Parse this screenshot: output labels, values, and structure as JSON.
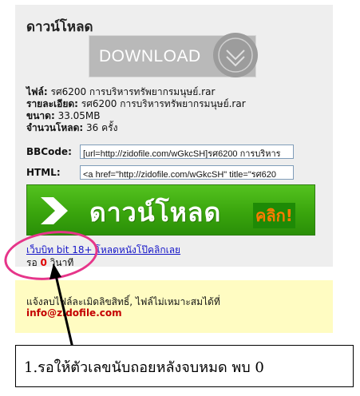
{
  "panel": {
    "title": "ดาวน์โหลด",
    "download_button_label": "DOWNLOAD",
    "file_label": "ไฟล์:",
    "file_value": "รศ6200 การบริหารทรัพยากรมนุษย์.rar",
    "detail_label": "รายละเอียด:",
    "detail_value": "รศ6200 การบริหารทรัพยากรมนุษย์.rar",
    "size_label": "ขนาด:",
    "size_value": "33.05MB",
    "downloads_label": "จำนวนโหลด:",
    "downloads_value": "36 ครั้ง",
    "bbcode_label": "BBCode:",
    "bbcode_value": "[url=http://zidofile.com/wGkcSH]รศ6200 การบริหาร",
    "html_label": "HTML:",
    "html_value": "<a href=\"http://zidofile.com/wGkcSH\" title=\"รศ620",
    "green_button_text": "ดาวน์โหลด",
    "green_button_click": "คลิก!",
    "promo_link": "เว็บบิท bit 18+ โหลดหนังโป๊คลิกเลย",
    "countdown_prefix": "รอ ",
    "countdown_value": "0",
    "countdown_suffix": " วินาที"
  },
  "report": {
    "line1": "แจ้งลบไฟล์ละเมิดลิขสิทธิ์, ไฟล์ไม่เหมาะสมได้ที่",
    "email": "info@zidofile.com"
  },
  "annotation": {
    "caption": "1.รอให้ตัวเลขนับถอยหลังจบหมด พบ 0"
  },
  "colors": {
    "panel_bg": "#eeeeee",
    "green_button": "#3aa50d",
    "click_text": "#ff7a00",
    "countdown_number": "#e00000",
    "link": "#1515c8",
    "highlight_circle": "#e6358a",
    "report_bg": "#fffcc2"
  },
  "icons": {
    "download_circle": "chevron-down-icon",
    "green_arrow": "arrow-right-icon"
  }
}
